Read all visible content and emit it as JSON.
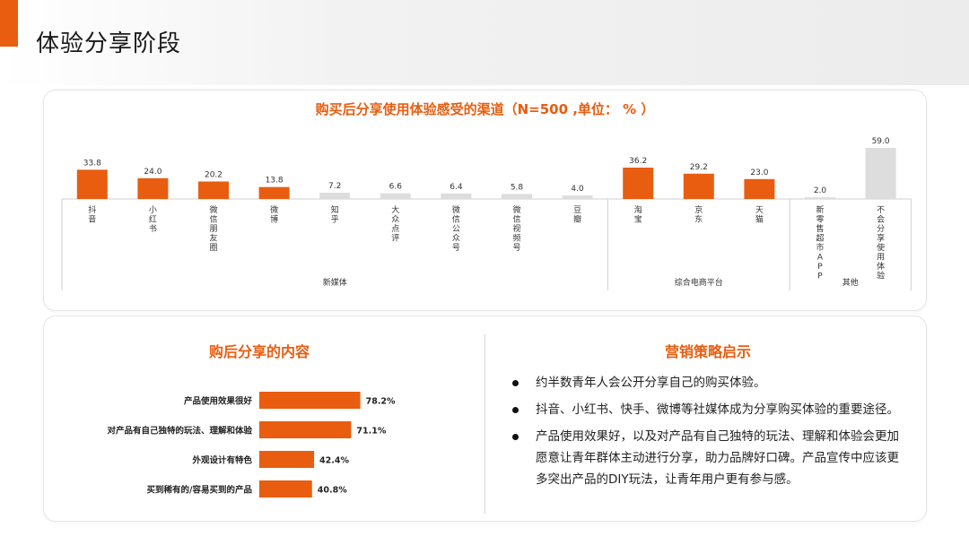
{
  "page": {
    "title": "体验分享阶段"
  },
  "chart_data": [
    {
      "type": "bar",
      "title": "购买后分享使用体验感受的渠道（N=500 ,单位： % ）",
      "categories": [
        "抖音",
        "小红书",
        "微信朋友圈",
        "微博",
        "知乎",
        "大众点评",
        "微信公众号",
        "微信视频号",
        "豆瓣",
        "淘宝",
        "京东",
        "天猫",
        "新零售超市APP",
        "不会分享使用体验"
      ],
      "values": [
        33.8,
        24.0,
        20.2,
        13.8,
        7.2,
        6.6,
        6.4,
        5.8,
        4.0,
        36.2,
        29.2,
        23.0,
        2.0,
        59.0
      ],
      "value_labels": [
        "33.8",
        "24.0",
        "20.2",
        "13.8",
        "7.2",
        "6.6",
        "6.4",
        "5.8",
        "4.0",
        "36.2",
        "29.2",
        "23.0",
        "2.0",
        "59.0"
      ],
      "groups": [
        {
          "name": "新媒体",
          "start": 0,
          "count": 9
        },
        {
          "name": "综合电商平台",
          "start": 9,
          "count": 3
        },
        {
          "name": "其他",
          "start": 12,
          "count": 2
        }
      ],
      "highlight": [
        true,
        true,
        true,
        true,
        false,
        false,
        false,
        false,
        false,
        true,
        true,
        true,
        false,
        false
      ],
      "ylim": [
        0,
        60
      ],
      "grid": false
    },
    {
      "type": "bar",
      "orientation": "horizontal",
      "title": "购后分享的内容",
      "categories": [
        "产品使用效果很好",
        "对产品有自己独特的玩法、理解和体验",
        "外观设计有特色",
        "买到稀有的/容易买到的产品"
      ],
      "values": [
        78.2,
        71.1,
        42.4,
        40.8
      ],
      "value_labels": [
        "78.2%",
        "71.1%",
        "42.4%",
        "40.8%"
      ],
      "xlim": [
        0,
        100
      ],
      "grid": false
    }
  ],
  "strategy": {
    "title": "营销策略启示",
    "items": [
      "约半数青年人会公开分享自己的购买体验。",
      "抖音、小红书、快手、微博等社媒体成为分享购买体验的重要途径。",
      "产品使用效果好，以及对产品有自己独特的玩法、理解和体验会更加愿意让青年群体主动进行分享，助力品牌好口碑。产品宣传中应该更多突出产品的DIY玩法，让青年用户更有参与感。"
    ]
  },
  "colors": {
    "accent": "#e85d10",
    "muted_bar": "#dddddd",
    "text": "#222222"
  }
}
